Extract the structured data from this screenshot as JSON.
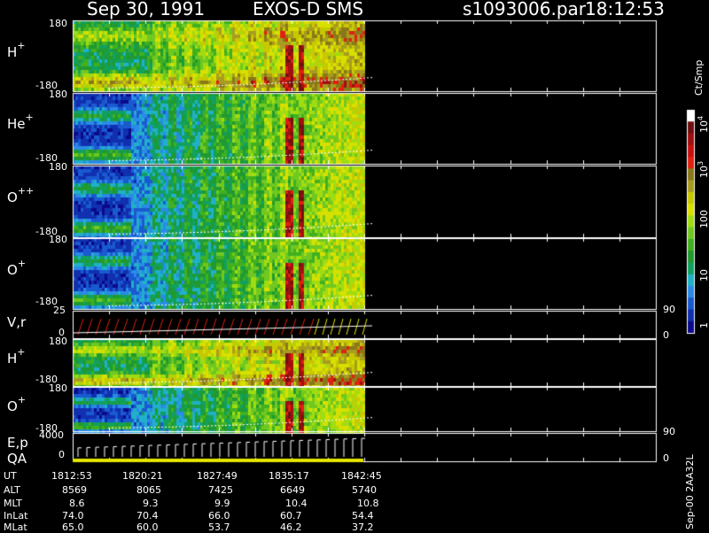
{
  "header": {
    "date": "Sep 30, 1991",
    "mission": "EXOS-D SMS",
    "file": "s1093006.par",
    "time": "18:12:53"
  },
  "chart_data": {
    "type": "heatmap",
    "panels": [
      {
        "label": "H",
        "superscript": "+",
        "ymax": "180",
        "ymin": "-180"
      },
      {
        "label": "He",
        "superscript": "+",
        "ymax": "180",
        "ymin": "-180"
      },
      {
        "label": "O",
        "superscript": "++",
        "ymax": "180",
        "ymin": "-180"
      },
      {
        "label": "O",
        "superscript": "+",
        "ymax": "180",
        "ymin": "-180"
      },
      {
        "label": "V,r",
        "superscript": "",
        "ymax": "25",
        "ymin": "0",
        "right_top": "90",
        "right_bottom": "0"
      },
      {
        "label": "H",
        "superscript": "+",
        "ymax": "180",
        "ymin": "-180"
      },
      {
        "label": "O",
        "superscript": "+",
        "ymax": "180",
        "ymin": "-180"
      },
      {
        "label": "E,p",
        "label2": "QA",
        "superscript": "",
        "ymax": "4000",
        "ymin": "0",
        "right_top": "90",
        "right_bottom": "0"
      }
    ],
    "colorbar": {
      "unit": "Ct/Smp",
      "ticks": [
        "1",
        "10",
        "100",
        "10",
        "10"
      ],
      "tick_exponents": [
        "",
        "",
        "",
        "3",
        "4"
      ]
    },
    "x_axis": {
      "rows": [
        {
          "name": "UT",
          "values": [
            "1812:53",
            "1820:21",
            "1827:49",
            "1835:17",
            "1842:45"
          ]
        },
        {
          "name": "ALT",
          "values": [
            "8569",
            "8065",
            "7425",
            "6649",
            "5740"
          ]
        },
        {
          "name": "MLT",
          "values": [
            "8.6",
            "9.3",
            "9.9",
            "10.4",
            "10.8"
          ]
        },
        {
          "name": "InLat",
          "values": [
            "74.0",
            "70.4",
            "66.0",
            "60.7",
            "54.4"
          ]
        },
        {
          "name": "MLat",
          "values": [
            "65.0",
            "60.0",
            "53.7",
            "46.2",
            "37.2"
          ]
        }
      ]
    },
    "stamp": "Sep-00 2AA32L"
  }
}
